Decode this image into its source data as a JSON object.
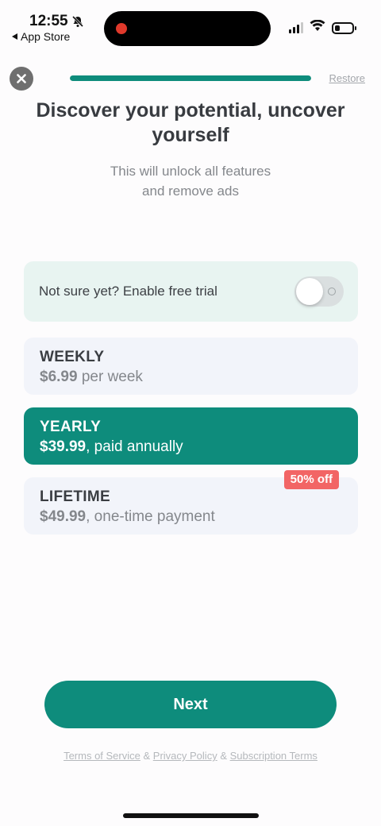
{
  "status_bar": {
    "time": "12:55",
    "back_app": "App Store",
    "silent_icon": "bell-slash-icon",
    "battery_level": 0.3
  },
  "header": {
    "close_icon": "close-icon",
    "progress": 1.0,
    "restore_label": "Restore"
  },
  "title": "Discover your potential, uncover yourself",
  "subtitle": "This will unlock all features\nand remove ads",
  "trial": {
    "label": "Not sure yet? Enable free trial",
    "enabled": false
  },
  "plans": [
    {
      "name": "WEEKLY",
      "price": "$6.99",
      "suffix": " per week",
      "selected": false
    },
    {
      "name": "YEARLY",
      "price": "$39.99",
      "suffix": ", paid annually",
      "selected": true
    },
    {
      "name": "LIFETIME",
      "price": "$49.99",
      "suffix": ", one-time payment",
      "selected": false,
      "badge": "50% off"
    }
  ],
  "next_label": "Next",
  "legal": {
    "terms": "Terms of Service",
    "sep1": " & ",
    "privacy": "Privacy Policy",
    "sep2": " & ",
    "subscription": "Subscription Terms"
  },
  "colors": {
    "accent": "#0e8c7c",
    "badge": "#f26565",
    "trial_bg": "#e8f4f1",
    "plan_bg": "#f2f4fa"
  }
}
